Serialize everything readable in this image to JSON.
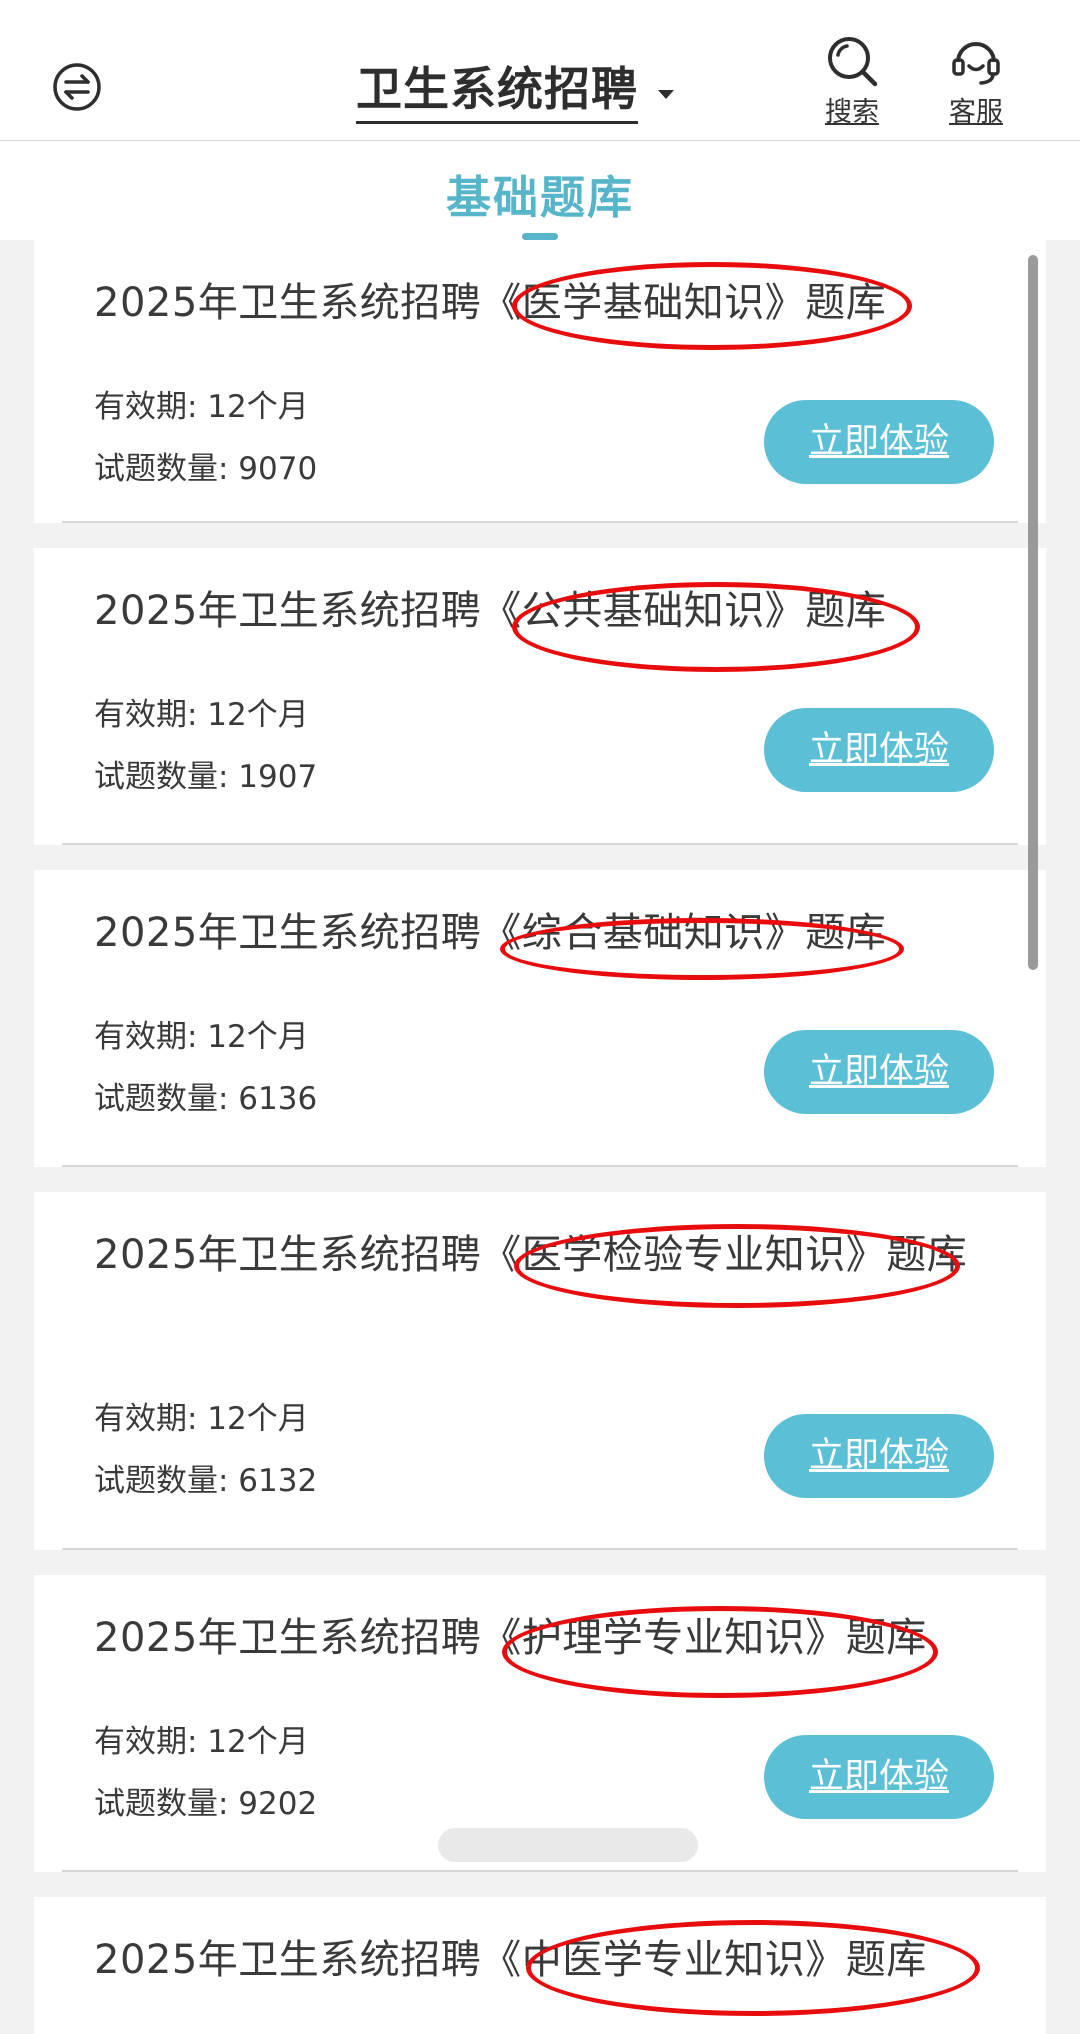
{
  "header": {
    "title": "卫生系统招聘",
    "search_label": "搜索",
    "service_label": "客服"
  },
  "tabs": [
    {
      "label": "基础题库",
      "active": true
    }
  ],
  "cards": [
    {
      "title": "2025年卫生系统招聘《医学基础知识》题库",
      "validity": "有效期: 12个月",
      "count": "试题数量: 9070",
      "button": "立即体验"
    },
    {
      "title": "2025年卫生系统招聘《公共基础知识》题库",
      "validity": "有效期: 12个月",
      "count": "试题数量: 1907",
      "button": "立即体验"
    },
    {
      "title": "2025年卫生系统招聘《综合基础知识》题库",
      "validity": "有效期: 12个月",
      "count": "试题数量: 6136",
      "button": "立即体验"
    },
    {
      "title": "2025年卫生系统招聘《医学检验专业知识》题库",
      "validity": "有效期: 12个月",
      "count": "试题数量: 6132",
      "button": "立即体验"
    },
    {
      "title": "2025年卫生系统招聘《护理学专业知识》题库",
      "validity": "有效期: 12个月",
      "count": "试题数量: 9202",
      "button": "立即体验"
    },
    {
      "title": "2025年卫生系统招聘《中医学专业知识》题库"
    }
  ],
  "colors": {
    "accent": "#56b5c8",
    "button": "#5bbfd6",
    "annotation": "#e80c0c"
  },
  "icons": {
    "menu": "switch-icon",
    "search": "search-icon",
    "service": "headset-icon",
    "dropdown": "caret-down-icon"
  }
}
